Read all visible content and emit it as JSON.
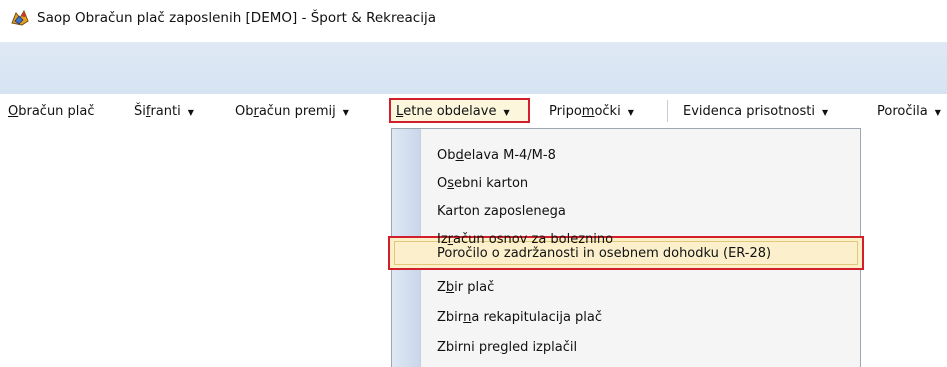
{
  "window": {
    "title": "Saop Obračun plač zaposlenih  [DEMO] - Šport & Rekreacija",
    "icon": "saop-app-icon"
  },
  "menubar": {
    "items": [
      {
        "label_pre": "",
        "label_u": "O",
        "label_post": "bračun plač",
        "has_arrow": false
      },
      {
        "label_pre": "Ši",
        "label_u": "f",
        "label_post": "ranti",
        "has_arrow": true
      },
      {
        "label_pre": "Ob",
        "label_u": "r",
        "label_post": "ačun premij",
        "has_arrow": true
      },
      {
        "label_pre": "",
        "label_u": "L",
        "label_post": "etne obdelave",
        "has_arrow": true,
        "active": true
      },
      {
        "label_pre": "Pripo",
        "label_u": "m",
        "label_post": "očki",
        "has_arrow": true
      },
      {
        "label_pre": "Evidenca prisotnosti",
        "label_u": "",
        "label_post": "",
        "has_arrow": true
      },
      {
        "label_pre": "Poročila",
        "label_u": "",
        "label_post": "",
        "has_arrow": true
      }
    ],
    "arrow_glyph": "▼"
  },
  "dropdown": {
    "items": [
      {
        "pre": "Ob",
        "u": "d",
        "post": "elava M-4/M-8"
      },
      {
        "pre": "O",
        "u": "s",
        "post": "ebni karton"
      },
      {
        "pre": "Karton zaposlenega",
        "u": "",
        "post": ""
      },
      {
        "pre": "Iz",
        "u": "r",
        "post": "ačun osnov za boleznino"
      },
      {
        "pre": "Poročilo o zadržanosti in osebnem dohodku  (ER-28)",
        "u": "",
        "post": "",
        "selected": true
      },
      {
        "pre": "Z",
        "u": "b",
        "post": "ir plač"
      },
      {
        "pre": "Zbir",
        "u": "n",
        "post": "a rekapitulacija plač"
      },
      {
        "pre": "Zbirni pre",
        "u": "g",
        "post": "led izplačil"
      }
    ]
  },
  "colors": {
    "highlight_border": "#d21f2b",
    "menubar_bg": "#d6e3f2",
    "selected_bg": "#fcf0cc"
  }
}
